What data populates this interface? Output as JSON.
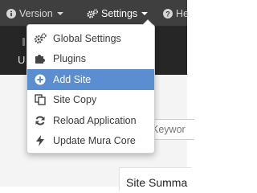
{
  "topbar": {
    "version_label": "Version",
    "settings_label": "Settings",
    "help_label": "He"
  },
  "subbar": {
    "label": "U"
  },
  "search": {
    "placeholder": "Keywor"
  },
  "summary": {
    "title": "Site Summa"
  },
  "settings_menu": {
    "items": [
      {
        "label": "Global Settings",
        "icon": "cogs-icon"
      },
      {
        "label": "Plugins",
        "icon": "puzzle-icon"
      },
      {
        "label": "Add Site",
        "icon": "plus-circle-icon",
        "highlighted": true
      },
      {
        "label": "Site Copy",
        "icon": "copy-icon"
      },
      {
        "label": "Reload Application",
        "icon": "refresh-icon"
      },
      {
        "label": "Update Mura Core",
        "icon": "bolt-icon"
      }
    ]
  },
  "colors": {
    "topbar": "#3f3f3f",
    "subbar": "#262626",
    "highlight": "#5b8ed0"
  }
}
